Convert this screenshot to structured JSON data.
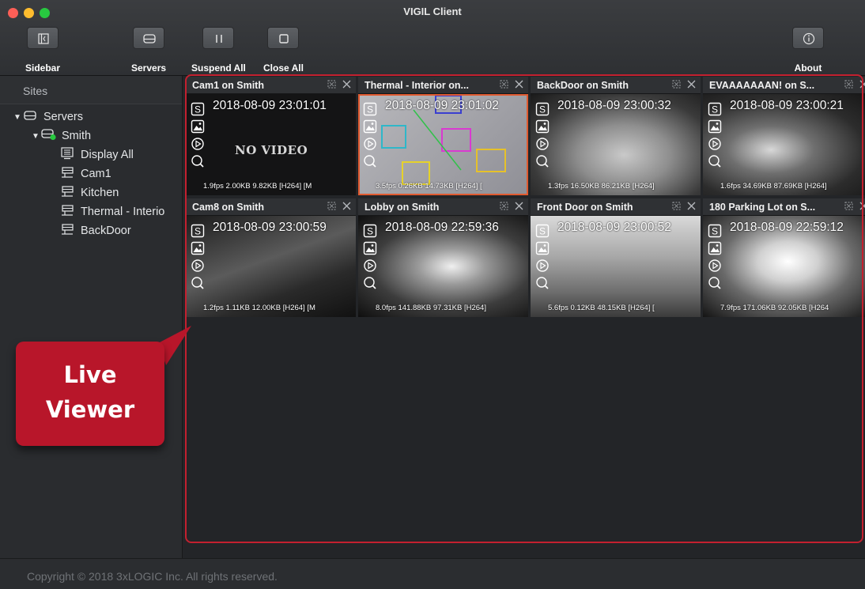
{
  "window": {
    "title": "VIGIL Client"
  },
  "toolbar": {
    "sidebar_label": "Sidebar",
    "servers_label": "Servers",
    "suspend_all_label": "Suspend All",
    "close_all_label": "Close All",
    "about_label": "About"
  },
  "sidebar": {
    "heading": "Sites",
    "tree": {
      "root_label": "Servers",
      "server_label": "Smith",
      "items": [
        {
          "label": "Display All",
          "icon": "display-all-icon"
        },
        {
          "label": "Cam1",
          "icon": "camera-icon"
        },
        {
          "label": "Kitchen",
          "icon": "camera-icon"
        },
        {
          "label": "Thermal - Interio",
          "icon": "camera-icon"
        },
        {
          "label": "BackDoor",
          "icon": "camera-icon"
        }
      ]
    }
  },
  "tiles": [
    {
      "title": "Cam1 on Smith",
      "timestamp": "2018-08-09 23:01:01",
      "stats": "1.9fps 2.00KB 9.82KB [H264] [M",
      "overlay": "NO VIDEO"
    },
    {
      "title": "Thermal - Interior on...",
      "timestamp": "2018-08-09 23:01:02",
      "stats": "3.5fps 0.26KB 14.73KB [H264] ["
    },
    {
      "title": "BackDoor on Smith",
      "timestamp": "2018-08-09 23:00:32",
      "stats": "1.3fps 16.50KB 86.21KB [H264]"
    },
    {
      "title": "EVAAAAAAAN! on S...",
      "timestamp": "2018-08-09 23:00:21",
      "stats": "1.6fps 34.69KB 87.69KB [H264]"
    },
    {
      "title": "Cam8 on Smith",
      "timestamp": "2018-08-09 23:00:59",
      "stats": "1.2fps 1.11KB 12.00KB [H264] [M"
    },
    {
      "title": "Lobby on Smith",
      "timestamp": "2018-08-09 22:59:36",
      "stats": "8.0fps 141.88KB 97.31KB [H264]"
    },
    {
      "title": "Front Door on Smith",
      "timestamp": "2018-08-09 23:00:52",
      "stats": "5.6fps 0.12KB 48.15KB [H264] ["
    },
    {
      "title": "180 Parking Lot on S...",
      "timestamp": "2018-08-09 22:59:12",
      "stats": "7.9fps 171.06KB 92.05KB [H264"
    }
  ],
  "callout": {
    "line1": "Live",
    "line2": "Viewer"
  },
  "footer": {
    "copyright": "Copyright © 2018 3xLOGIC Inc. All rights reserved."
  },
  "colors": {
    "accent_red": "#c3202f",
    "callout_red": "#b8162a",
    "status_green": "#28c840"
  }
}
